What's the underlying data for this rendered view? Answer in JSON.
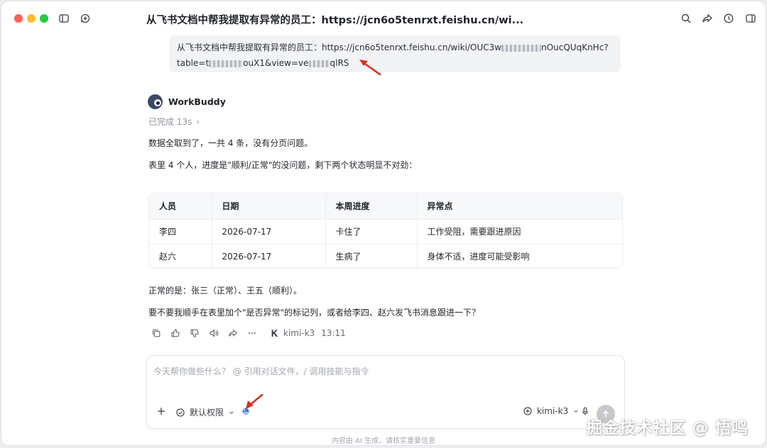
{
  "window": {
    "title": "从飞书文档中帮我提取有异常的员工：https://jcn6o5tenrxt.feishu.cn/wi..."
  },
  "user_message": {
    "line1_a": "从飞书文档中帮我提取有异常的员工：https://jcn6o5tenrxt.feishu.cn/wiki/OUC3w",
    "line1_b": "nOucQUqKnHc?",
    "line2_a": "table=t",
    "line2_b": "ouX1&view=ve",
    "line2_c": "qlRS"
  },
  "bot": {
    "name": "WorkBuddy",
    "status": "已完成 13s",
    "p1": "数据全取到了，一共 4 条，没有分页问题。",
    "p2": "表里 4 个人，进度是\"顺利/正常\"的没问题，剩下两个状态明显不对劲：",
    "p3": "正常的是：张三（正常）、王五（顺利）。",
    "p4": "要不要我顺手在表里加个\"是否异常\"的标记列，或者给李四、赵六发飞书消息跟进一下？"
  },
  "table": {
    "headers": [
      "人员",
      "日期",
      "本周进度",
      "异常点"
    ],
    "rows": [
      [
        "李四",
        "2026-07-17",
        "卡住了",
        "工作受阻，需要跟进原因"
      ],
      [
        "赵六",
        "2026-07-17",
        "生病了",
        "身体不适，进度可能受影响"
      ]
    ]
  },
  "message_meta": {
    "model": "kimi-k3",
    "time": "13:11"
  },
  "composer": {
    "placeholder": "今天帮你做些什么？ @ 引用对话文件，/ 调用技能与指令",
    "permission_label": "默认权限",
    "model_label": "kimi-k3"
  },
  "footer": {
    "note": "内容由 AI 生成，请核实重要信息"
  },
  "watermark": {
    "text": "掘金技术社区 @ 悟鸣"
  },
  "colors": {
    "accent_arrow": "#d93025",
    "surface": "#f2f3f5"
  }
}
